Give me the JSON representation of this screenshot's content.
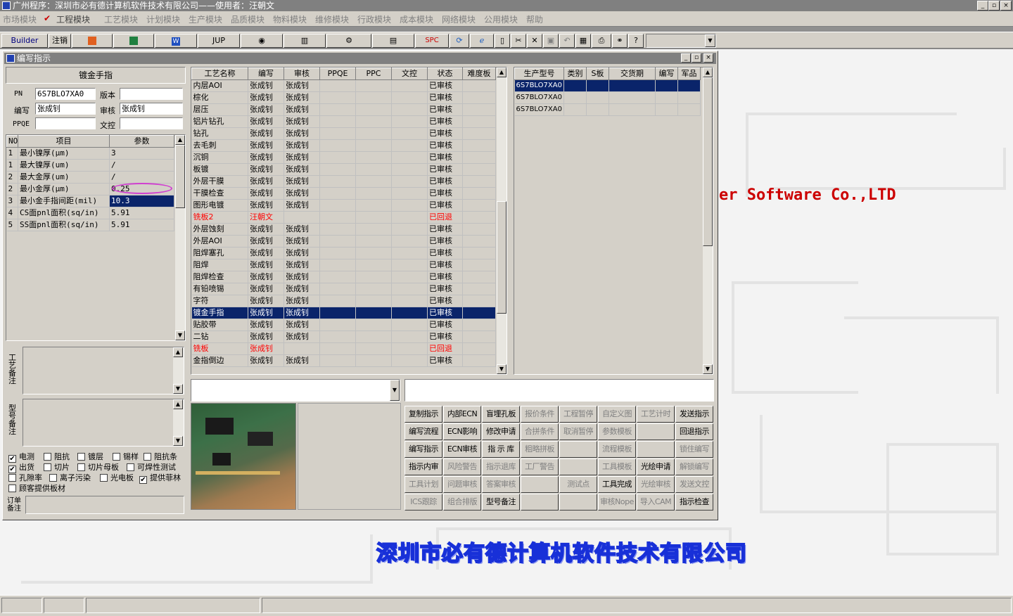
{
  "app": {
    "title": "广州程序：深圳市必有德计算机软件技术有限公司——使用者：汪朝文",
    "title_buttons": [
      "_",
      "▫",
      "×"
    ],
    "menus": [
      "市场模块",
      "工程模块",
      "工艺模块",
      "计划模块",
      "生产模块",
      "品质模块",
      "物料模块",
      "维修模块",
      "行政模块",
      "成本模块",
      "网络模块",
      "公用模块",
      "帮助"
    ]
  },
  "toolbar": {
    "builder": "Builder",
    "logout": "注销",
    "jup": "JUP",
    "spc": "SPC",
    "icons": [
      "ppt-icon",
      "excel-icon",
      "word-icon",
      "eye-icon",
      "database-icon",
      "chart-icon",
      "printer-monitor-icon",
      "refresh-icon",
      "ie-icon",
      "new-file-icon",
      "cut-icon",
      "close-icon",
      "save-icon",
      "undo-icon",
      "preview-icon",
      "print-icon",
      "binoculars-icon",
      "help-icon"
    ]
  },
  "desktop": {
    "company_en": "er Software Co.,LTD",
    "company_cn": "深圳市必有德计算机软件技术有限公司"
  },
  "window": {
    "title": "编写指示",
    "header_label": "镀金手指",
    "fields": {
      "pn_label": "PN",
      "pn_value": "6S7BLO7XA0",
      "version_label": "版本",
      "version_value": "",
      "author_label": "编写",
      "author_value": "张成钊",
      "review_label": "审核",
      "review_value": "张成钊",
      "ppqe_label": "PPQE",
      "ppqe_value": "",
      "doc_label": "文控",
      "doc_value": ""
    },
    "param_columns": [
      "NO",
      "项目",
      "参数"
    ],
    "params": [
      {
        "no": "1",
        "item": "最小镍厚(μm)",
        "value": "3"
      },
      {
        "no": "1",
        "item": "最大镍厚(um)",
        "value": "/"
      },
      {
        "no": "2",
        "item": "最大金厚(um)",
        "value": "/"
      },
      {
        "no": "2",
        "item": "最小金厚(μm)",
        "value": "0.25"
      },
      {
        "no": "3",
        "item": "最小金手指间距(mil)",
        "value": "10.3"
      },
      {
        "no": "4",
        "item": "CS面pnl面积(sq/in)",
        "value": "5.91"
      },
      {
        "no": "5",
        "item": "SS面pnl面积(sq/in)",
        "value": "5.91"
      }
    ],
    "process_note_label": "工艺备注",
    "model_note_label": "型号备注",
    "order_note_label": "订单备注",
    "checkboxes": [
      {
        "label": "电测",
        "checked": true
      },
      {
        "label": "阻抗",
        "checked": false
      },
      {
        "label": "镀层",
        "checked": false
      },
      {
        "label": "锡样",
        "checked": false
      },
      {
        "label": "阻抗条",
        "checked": false
      },
      {
        "label": "出货",
        "checked": true
      },
      {
        "label": "切片",
        "checked": false
      },
      {
        "label": "切片母板",
        "checked": false
      },
      {
        "label": "可焊性测试",
        "checked": false
      },
      {
        "label": "孔隙率",
        "checked": false
      },
      {
        "label": "离子污染",
        "checked": false
      },
      {
        "label": "光电板",
        "checked": false
      },
      {
        "label": "提供菲林",
        "checked": true
      },
      {
        "label": "顾客提供板材",
        "checked": false
      }
    ],
    "process_columns": [
      "工艺名称",
      "编写",
      "审核",
      "PPQE",
      "PPC",
      "文控",
      "状态",
      "难度板"
    ],
    "processes": [
      {
        "name": "内层AOI",
        "author": "张成钊",
        "review": "张成钊",
        "ppqe": "",
        "ppc": "",
        "doc": "",
        "status": "已审核",
        "diff": ""
      },
      {
        "name": "棕化",
        "author": "张成钊",
        "review": "张成钊",
        "ppqe": "",
        "ppc": "",
        "doc": "",
        "status": "已审核",
        "diff": ""
      },
      {
        "name": "层压",
        "author": "张成钊",
        "review": "张成钊",
        "ppqe": "",
        "ppc": "",
        "doc": "",
        "status": "已审核",
        "diff": ""
      },
      {
        "name": "铝片钻孔",
        "author": "张成钊",
        "review": "张成钊",
        "ppqe": "",
        "ppc": "",
        "doc": "",
        "status": "已审核",
        "diff": ""
      },
      {
        "name": "钻孔",
        "author": "张成钊",
        "review": "张成钊",
        "ppqe": "",
        "ppc": "",
        "doc": "",
        "status": "已审核",
        "diff": ""
      },
      {
        "name": "去毛刺",
        "author": "张成钊",
        "review": "张成钊",
        "ppqe": "",
        "ppc": "",
        "doc": "",
        "status": "已审核",
        "diff": ""
      },
      {
        "name": "沉铜",
        "author": "张成钊",
        "review": "张成钊",
        "ppqe": "",
        "ppc": "",
        "doc": "",
        "status": "已审核",
        "diff": ""
      },
      {
        "name": "板镀",
        "author": "张成钊",
        "review": "张成钊",
        "ppqe": "",
        "ppc": "",
        "doc": "",
        "status": "已审核",
        "diff": ""
      },
      {
        "name": "外层干膜",
        "author": "张成钊",
        "review": "张成钊",
        "ppqe": "",
        "ppc": "",
        "doc": "",
        "status": "已审核",
        "diff": ""
      },
      {
        "name": "干膜检查",
        "author": "张成钊",
        "review": "张成钊",
        "ppqe": "",
        "ppc": "",
        "doc": "",
        "status": "已审核",
        "diff": ""
      },
      {
        "name": "图形电镀",
        "author": "张成钊",
        "review": "张成钊",
        "ppqe": "",
        "ppc": "",
        "doc": "",
        "status": "已审核",
        "diff": ""
      },
      {
        "name": "铣板2",
        "author": "汪朝文",
        "review": "",
        "ppqe": "",
        "ppc": "",
        "doc": "",
        "status": "已回退",
        "diff": "",
        "red": true
      },
      {
        "name": "外层蚀刻",
        "author": "张成钊",
        "review": "张成钊",
        "ppqe": "",
        "ppc": "",
        "doc": "",
        "status": "已审核",
        "diff": ""
      },
      {
        "name": "外层AOI",
        "author": "张成钊",
        "review": "张成钊",
        "ppqe": "",
        "ppc": "",
        "doc": "",
        "status": "已审核",
        "diff": ""
      },
      {
        "name": "阻焊塞孔",
        "author": "张成钊",
        "review": "张成钊",
        "ppqe": "",
        "ppc": "",
        "doc": "",
        "status": "已审核",
        "diff": ""
      },
      {
        "name": "阻焊",
        "author": "张成钊",
        "review": "张成钊",
        "ppqe": "",
        "ppc": "",
        "doc": "",
        "status": "已审核",
        "diff": ""
      },
      {
        "name": "阻焊检查",
        "author": "张成钊",
        "review": "张成钊",
        "ppqe": "",
        "ppc": "",
        "doc": "",
        "status": "已审核",
        "diff": ""
      },
      {
        "name": "有铅喷锡",
        "author": "张成钊",
        "review": "张成钊",
        "ppqe": "",
        "ppc": "",
        "doc": "",
        "status": "已审核",
        "diff": ""
      },
      {
        "name": "字符",
        "author": "张成钊",
        "review": "张成钊",
        "ppqe": "",
        "ppc": "",
        "doc": "",
        "status": "已审核",
        "diff": ""
      },
      {
        "name": "镀金手指",
        "author": "张成钊",
        "review": "张成钊",
        "ppqe": "",
        "ppc": "",
        "doc": "",
        "status": "已审核",
        "diff": "",
        "selected": true
      },
      {
        "name": "贴胶带",
        "author": "张成钊",
        "review": "张成钊",
        "ppqe": "",
        "ppc": "",
        "doc": "",
        "status": "已审核",
        "diff": ""
      },
      {
        "name": "二钻",
        "author": "张成钊",
        "review": "张成钊",
        "ppqe": "",
        "ppc": "",
        "doc": "",
        "status": "已审核",
        "diff": ""
      },
      {
        "name": "铣板",
        "author": "张成钊",
        "review": "",
        "ppqe": "",
        "ppc": "",
        "doc": "",
        "status": "已回退",
        "diff": "",
        "red": true
      },
      {
        "name": "金指倒边",
        "author": "张成钊",
        "review": "张成钊",
        "ppqe": "",
        "ppc": "",
        "doc": "",
        "status": "已审核",
        "diff": ""
      }
    ],
    "model_columns": [
      "生产型号",
      "类别",
      "S板",
      "交货期",
      "编写",
      "军品"
    ],
    "models": [
      {
        "model": "6S7BLO7XA0",
        "selected": true
      },
      {
        "model": "6S7BLO7XA0"
      },
      {
        "model": "6S7BLO7XA0"
      }
    ],
    "buttons": [
      [
        {
          "label": "复制指示",
          "enabled": true
        },
        {
          "label": "内部ECN",
          "enabled": true
        },
        {
          "label": "盲埋孔板",
          "enabled": true
        },
        {
          "label": "报价条件",
          "enabled": false
        },
        {
          "label": "工程暂停",
          "enabled": false
        },
        {
          "label": "自定义图",
          "enabled": false
        },
        {
          "label": "工艺计时",
          "enabled": false
        },
        {
          "label": "发送指示",
          "enabled": true
        }
      ],
      [
        {
          "label": "编写流程",
          "enabled": true
        },
        {
          "label": "ECN影响",
          "enabled": true
        },
        {
          "label": "修改申请",
          "enabled": true
        },
        {
          "label": "合拼条件",
          "enabled": false
        },
        {
          "label": "取消暂停",
          "enabled": false
        },
        {
          "label": "参数模板",
          "enabled": false
        },
        {
          "label": "",
          "enabled": false
        },
        {
          "label": "回退指示",
          "enabled": true
        }
      ],
      [
        {
          "label": "编写指示",
          "enabled": true
        },
        {
          "label": "ECN审核",
          "enabled": true
        },
        {
          "label": "指 示 库",
          "enabled": true
        },
        {
          "label": "粗略拼板",
          "enabled": false
        },
        {
          "label": "",
          "enabled": false
        },
        {
          "label": "流程模板",
          "enabled": false
        },
        {
          "label": "",
          "enabled": false
        },
        {
          "label": "锁住编写",
          "enabled": false
        }
      ],
      [
        {
          "label": "指示内审",
          "enabled": true
        },
        {
          "label": "风险警告",
          "enabled": false
        },
        {
          "label": "指示退库",
          "enabled": false
        },
        {
          "label": "工厂警告",
          "enabled": false
        },
        {
          "label": "",
          "enabled": false
        },
        {
          "label": "工具模板",
          "enabled": false
        },
        {
          "label": "光绘申请",
          "enabled": true
        },
        {
          "label": "解锁编写",
          "enabled": false
        }
      ],
      [
        {
          "label": "工具计划",
          "enabled": false
        },
        {
          "label": "问题审核",
          "enabled": false
        },
        {
          "label": "答案审核",
          "enabled": false
        },
        {
          "label": "",
          "enabled": false
        },
        {
          "label": "测试点",
          "enabled": false
        },
        {
          "label": "工具完成",
          "enabled": true
        },
        {
          "label": "光绘审核",
          "enabled": false
        },
        {
          "label": "发送文控",
          "enabled": false
        }
      ],
      [
        {
          "label": "ICS跟踪",
          "enabled": false
        },
        {
          "label": "组合排版",
          "enabled": false
        },
        {
          "label": "型号备注",
          "enabled": true
        },
        {
          "label": "",
          "enabled": false
        },
        {
          "label": "",
          "enabled": false
        },
        {
          "label": "审核Nope",
          "enabled": false
        },
        {
          "label": "导入CAM",
          "enabled": false
        },
        {
          "label": "指示检查",
          "enabled": true
        }
      ]
    ]
  }
}
